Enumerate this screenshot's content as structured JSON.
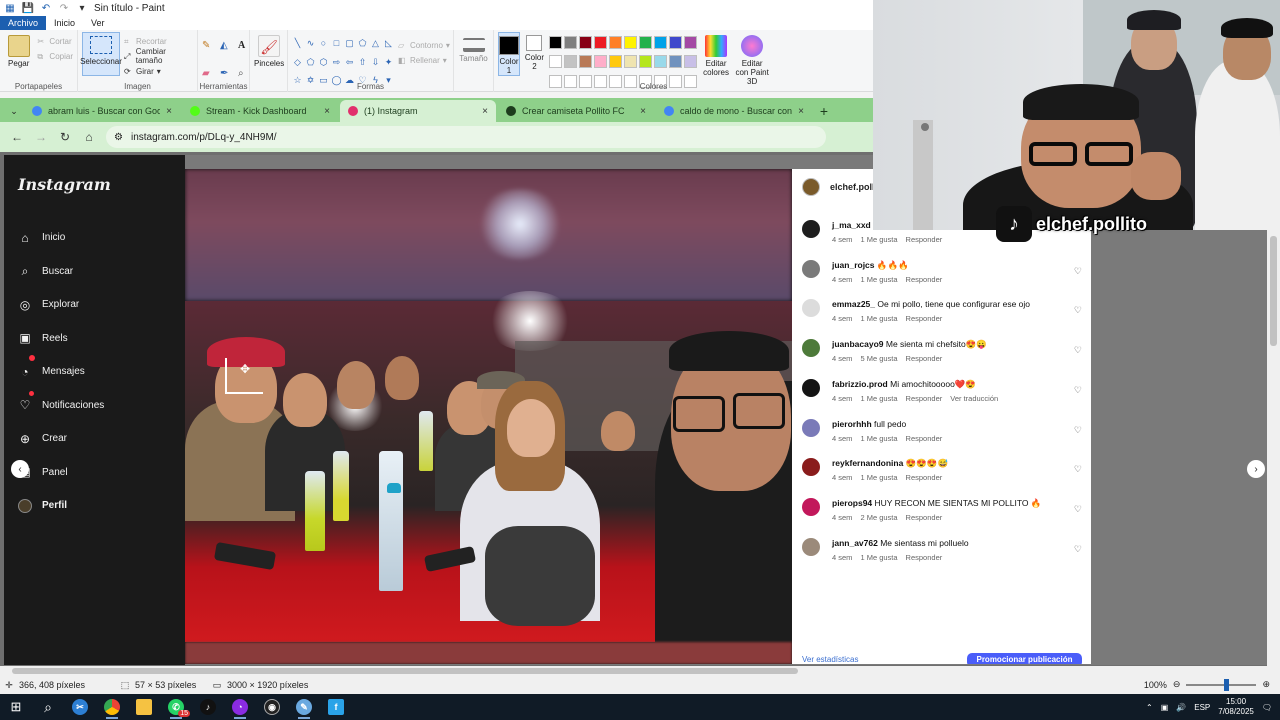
{
  "paint": {
    "title": "Sin título - Paint",
    "menu": [
      "Archivo",
      "Inicio",
      "Ver"
    ],
    "ribbon": {
      "portapapeles": {
        "label": "Portapapeles",
        "pegar": "Pegar",
        "cortar": "Cortar",
        "copiar": "Copiar"
      },
      "imagen": {
        "label": "Imagen",
        "seleccionar": "Seleccionar",
        "recortar": "Recortar",
        "cambiar_tamano": "Cambiar tamaño",
        "girar": "Girar"
      },
      "herramientas": {
        "label": "Herramientas"
      },
      "pinceles": "Pinceles",
      "formas": {
        "label": "Formas",
        "contorno": "Contorno",
        "rellenar": "Rellenar"
      },
      "tamano": "Tamaño",
      "colores": {
        "label": "Colores",
        "color1": "Color 1",
        "color2": "Color 2",
        "editar_colores": "Editar colores",
        "editar_paint3d": "Editar con Paint 3D"
      },
      "palette": [
        "#000000",
        "#7f7f7f",
        "#880015",
        "#ed1c24",
        "#ff7f27",
        "#fff200",
        "#22b14c",
        "#00a2e8",
        "#3f48cc",
        "#a349a4",
        "#ffffff",
        "#c3c3c3",
        "#b97a57",
        "#ffaec9",
        "#ffc90e",
        "#efe4b0",
        "#b5e61d",
        "#99d9ea",
        "#7092be",
        "#c8bfe7",
        "#ffffff",
        "#ffffff",
        "#ffffff",
        "#ffffff",
        "#ffffff",
        "#ffffff",
        "#ffffff",
        "#ffffff",
        "#ffffff",
        "#ffffff"
      ]
    },
    "status": {
      "cursor_pos": "366, 408 píxeles",
      "selection_size": "57 × 53 píxeles",
      "image_size": "3000 × 1920 píxeles",
      "zoom": "100%"
    }
  },
  "browser": {
    "tabs": [
      {
        "label": "abram luis - Buscar con Google",
        "favicon_color": "#4285f4"
      },
      {
        "label": "Stream - Kick Dashboard",
        "favicon_color": "#53fc18"
      },
      {
        "label": "(1) Instagram",
        "favicon_color": "#e1306c"
      },
      {
        "label": "Crear camiseta Pollito FC",
        "favicon_color": "#1d3c1d"
      },
      {
        "label": "caldo de mono - Buscar con Google",
        "favicon_color": "#4285f4"
      }
    ],
    "active_tab": 2,
    "url": "instagram.com/p/DLq-y_4NH9M/"
  },
  "instagram": {
    "logo": "Instagram",
    "nav": [
      {
        "label": "Inicio",
        "icon": "home-icon",
        "glyph": "⌂"
      },
      {
        "label": "Buscar",
        "icon": "search-icon",
        "glyph": "⌕"
      },
      {
        "label": "Explorar",
        "icon": "compass-icon",
        "glyph": "◎"
      },
      {
        "label": "Reels",
        "icon": "reels-icon",
        "glyph": "▣"
      },
      {
        "label": "Mensajes",
        "icon": "messenger-icon",
        "glyph": "◔"
      },
      {
        "label": "Notificaciones",
        "icon": "heart-icon",
        "glyph": "♡"
      },
      {
        "label": "Crear",
        "icon": "plus-icon",
        "glyph": "⊕"
      },
      {
        "label": "Panel",
        "icon": "dashboard-icon",
        "glyph": "▤"
      },
      {
        "label": "Perfil",
        "icon": "profile-avatar",
        "glyph": ""
      }
    ],
    "post_author": "elchef.pollit",
    "comments": [
      {
        "user": "j_ma_xxd",
        "text": "",
        "time": "4 sem",
        "likes": "1 Me gusta",
        "reply": "Responder",
        "extra": "",
        "avatar": "#1e1e1e"
      },
      {
        "user": "juan_rojcs",
        "text": "🔥🔥🔥",
        "time": "4 sem",
        "likes": "1 Me gusta",
        "reply": "Responder",
        "extra": "",
        "avatar": "#7a7a7a"
      },
      {
        "user": "emmaz25_",
        "text": "Oe mi pollo, tiene que configurar ese ojo",
        "time": "4 sem",
        "likes": "1 Me gusta",
        "reply": "Responder",
        "extra": "",
        "avatar": "#dcdcdc"
      },
      {
        "user": "juanbacayo9",
        "text": "Me sienta mi chefsito😍😛",
        "time": "4 sem",
        "likes": "5 Me gusta",
        "reply": "Responder",
        "extra": "",
        "avatar": "#4d7a3a"
      },
      {
        "user": "fabrizzio.prod",
        "text": "Mi amochitooooo❤️😍",
        "time": "4 sem",
        "likes": "1 Me gusta",
        "reply": "Responder",
        "extra": "Ver traducción",
        "avatar": "#141414"
      },
      {
        "user": "pierorhhh",
        "text": "full pedo",
        "time": "4 sem",
        "likes": "1 Me gusta",
        "reply": "Responder",
        "extra": "",
        "avatar": "#7a7ab8"
      },
      {
        "user": "reykfernandonina",
        "text": "😍😍😍😅",
        "time": "4 sem",
        "likes": "1 Me gusta",
        "reply": "Responder",
        "extra": "",
        "avatar": "#8a1c1c"
      },
      {
        "user": "pierops94",
        "text": "HUY RECON ME SIENTAS MI POLLITO 🔥",
        "time": "4 sem",
        "likes": "2 Me gusta",
        "reply": "Responder",
        "extra": "",
        "avatar": "#c2185b"
      },
      {
        "user": "jann_av762",
        "text": "Me sientass mi polluelo",
        "time": "4 sem",
        "likes": "1 Me gusta",
        "reply": "Responder",
        "extra": "",
        "avatar": "#9b8a7a"
      }
    ],
    "footer": {
      "stats": "Ver estadísticas",
      "promote": "Promocionar publicación"
    }
  },
  "overlay": {
    "tiktok_handle": "elchef.pollito"
  },
  "taskbar": {
    "lang": "ESP",
    "time": "15:00",
    "date": "7/08/2025",
    "whatsapp_badge": "15"
  }
}
